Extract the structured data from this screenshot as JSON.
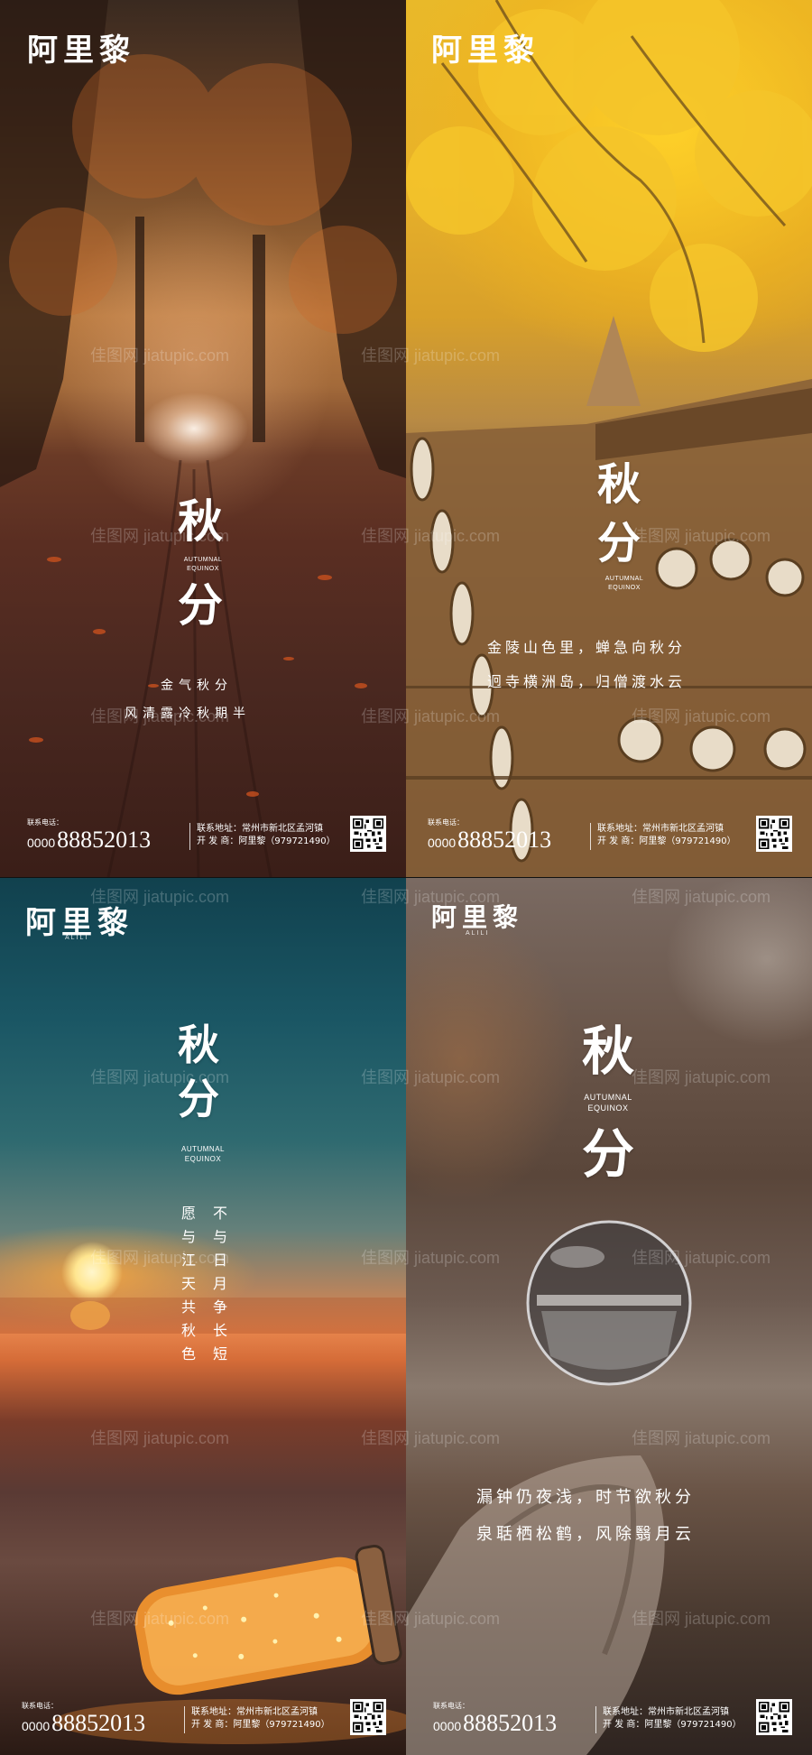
{
  "watermark": "佳图网 jiatupic.com",
  "colors": {
    "text": "#ffffff",
    "poster1_accent": "#8a5a30",
    "poster2_accent": "#e9b929",
    "poster3_accent": "#1a5664",
    "poster4_accent": "#6a564a"
  },
  "posters": [
    {
      "brand": "阿里黎",
      "title_1": "秋",
      "title_2": "分",
      "en_1": "AUTUMNAL",
      "en_2": "EQUINOX",
      "poem_1": "金气秋分",
      "poem_2": "风清露冷秋期半",
      "phone_label": "联系电话：",
      "phone_prefix": "0000",
      "phone_number": "88852013",
      "address": "联系地址：常州市新北区孟河镇",
      "developer": "开 发 商：阿里黎（979721490）"
    },
    {
      "brand": "阿里黎",
      "title_1": "秋",
      "title_2": "分",
      "en_1": "AUTUMNAL",
      "en_2": "EQUINOX",
      "poem_1": "金陵山色里，蝉急向秋分",
      "poem_2": "迥寺横洲岛，归僧渡水云",
      "phone_label": "联系电话：",
      "phone_prefix": "0000",
      "phone_number": "88852013",
      "address": "联系地址：常州市新北区孟河镇",
      "developer": "开 发 商：阿里黎（979721490）"
    },
    {
      "brand": "阿里黎",
      "brand_sub": "ALILI",
      "title_1": "秋",
      "title_2": "分",
      "en_1": "AUTUMNAL",
      "en_2": "EQUINOX",
      "poem_col_1": "不与日月争长短",
      "poem_col_2": "愿与江天共秋色",
      "phone_label": "联系电话：",
      "phone_prefix": "0000",
      "phone_number": "88852013",
      "address": "联系地址：常州市新北区孟河镇",
      "developer": "开 发 商：阿里黎（979721490）"
    },
    {
      "brand": "阿里黎",
      "brand_sub": "ALILI",
      "title_1": "秋",
      "title_2": "分",
      "en_1": "AUTUMNAL",
      "en_2": "EQUINOX",
      "poem_1": "漏钟仍夜浅，时节欲秋分",
      "poem_2": "泉聒栖松鹤，风除翳月云",
      "phone_label": "联系电话：",
      "phone_prefix": "0000",
      "phone_number": "88852013",
      "address": "联系地址：常州市新北区孟河镇",
      "developer": "开 发 商：阿里黎（979721490）"
    }
  ]
}
